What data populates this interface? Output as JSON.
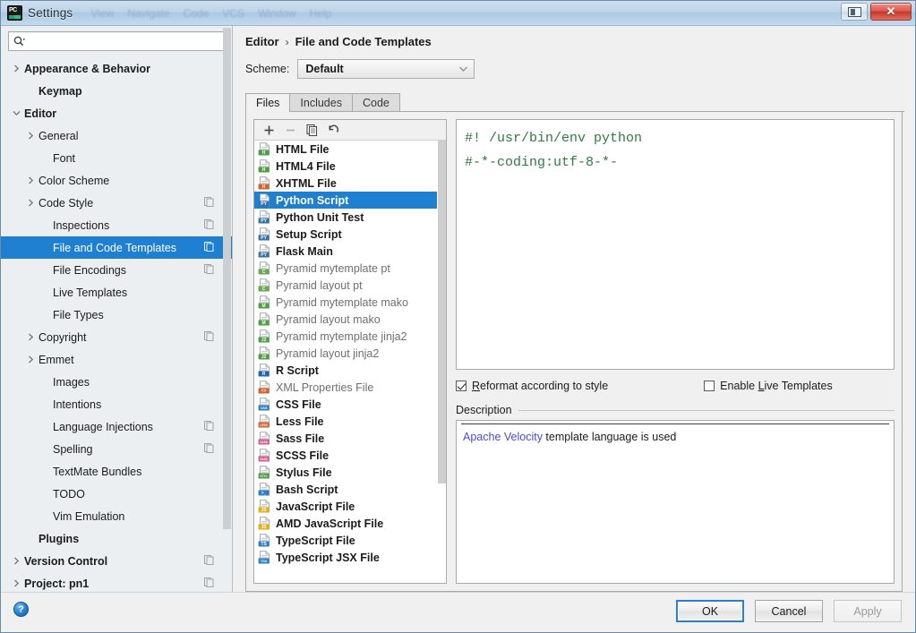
{
  "window": {
    "title": "Settings",
    "app_icon": "pycharm-icon",
    "ghost_menu": [
      "View",
      "Navigate",
      "Code",
      "VCS",
      "Window",
      "Help"
    ],
    "restore_label": "",
    "close_label": "✕"
  },
  "search": {
    "value": "",
    "placeholder": ""
  },
  "sidebar": {
    "items": [
      {
        "label": "Appearance & Behavior",
        "bold": true,
        "indent": 0,
        "twisty": "collapsed",
        "badge": false,
        "selected": false
      },
      {
        "label": "Keymap",
        "bold": true,
        "indent": 1,
        "twisty": "none",
        "badge": false,
        "selected": false
      },
      {
        "label": "Editor",
        "bold": true,
        "indent": 0,
        "twisty": "expanded",
        "badge": false,
        "selected": false
      },
      {
        "label": "General",
        "bold": false,
        "indent": 1,
        "twisty": "collapsed",
        "badge": false,
        "selected": false
      },
      {
        "label": "Font",
        "bold": false,
        "indent": 2,
        "twisty": "none",
        "badge": false,
        "selected": false
      },
      {
        "label": "Color Scheme",
        "bold": false,
        "indent": 1,
        "twisty": "collapsed",
        "badge": false,
        "selected": false
      },
      {
        "label": "Code Style",
        "bold": false,
        "indent": 1,
        "twisty": "collapsed",
        "badge": true,
        "selected": false
      },
      {
        "label": "Inspections",
        "bold": false,
        "indent": 2,
        "twisty": "none",
        "badge": true,
        "selected": false
      },
      {
        "label": "File and Code Templates",
        "bold": false,
        "indent": 2,
        "twisty": "none",
        "badge": true,
        "selected": true
      },
      {
        "label": "File Encodings",
        "bold": false,
        "indent": 2,
        "twisty": "none",
        "badge": true,
        "selected": false
      },
      {
        "label": "Live Templates",
        "bold": false,
        "indent": 2,
        "twisty": "none",
        "badge": false,
        "selected": false
      },
      {
        "label": "File Types",
        "bold": false,
        "indent": 2,
        "twisty": "none",
        "badge": false,
        "selected": false
      },
      {
        "label": "Copyright",
        "bold": false,
        "indent": 1,
        "twisty": "collapsed",
        "badge": true,
        "selected": false
      },
      {
        "label": "Emmet",
        "bold": false,
        "indent": 1,
        "twisty": "collapsed",
        "badge": false,
        "selected": false
      },
      {
        "label": "Images",
        "bold": false,
        "indent": 2,
        "twisty": "none",
        "badge": false,
        "selected": false
      },
      {
        "label": "Intentions",
        "bold": false,
        "indent": 2,
        "twisty": "none",
        "badge": false,
        "selected": false
      },
      {
        "label": "Language Injections",
        "bold": false,
        "indent": 2,
        "twisty": "none",
        "badge": true,
        "selected": false
      },
      {
        "label": "Spelling",
        "bold": false,
        "indent": 2,
        "twisty": "none",
        "badge": true,
        "selected": false
      },
      {
        "label": "TextMate Bundles",
        "bold": false,
        "indent": 2,
        "twisty": "none",
        "badge": false,
        "selected": false
      },
      {
        "label": "TODO",
        "bold": false,
        "indent": 2,
        "twisty": "none",
        "badge": false,
        "selected": false
      },
      {
        "label": "Vim Emulation",
        "bold": false,
        "indent": 2,
        "twisty": "none",
        "badge": false,
        "selected": false
      },
      {
        "label": "Plugins",
        "bold": true,
        "indent": 1,
        "twisty": "none",
        "badge": false,
        "selected": false
      },
      {
        "label": "Version Control",
        "bold": true,
        "indent": 0,
        "twisty": "collapsed",
        "badge": true,
        "selected": false
      },
      {
        "label": "Project: pn1",
        "bold": true,
        "indent": 0,
        "twisty": "collapsed",
        "badge": true,
        "selected": false
      }
    ]
  },
  "main": {
    "breadcrumb": {
      "parent": "Editor",
      "separator": "›",
      "current": "File and Code Templates"
    },
    "scheme": {
      "label": "Scheme:",
      "value": "Default"
    },
    "tabs": [
      {
        "label": "Files",
        "active": true
      },
      {
        "label": "Includes",
        "active": false
      },
      {
        "label": "Code",
        "active": false
      }
    ],
    "list_toolbar": [
      {
        "name": "add-template-button",
        "glyph": "+",
        "disabled": false
      },
      {
        "name": "remove-template-button",
        "glyph": "−",
        "disabled": true
      },
      {
        "name": "copy-template-button",
        "glyph": "copy",
        "disabled": false
      },
      {
        "name": "reset-template-button",
        "glyph": "undo",
        "disabled": false
      }
    ],
    "templates": [
      {
        "label": "HTML File",
        "bold": true,
        "icon": "html-file-icon",
        "badge": "H",
        "badge_color": "#4f9e46",
        "selected": false
      },
      {
        "label": "HTML4 File",
        "bold": true,
        "icon": "html4-file-icon",
        "badge": "H",
        "badge_color": "#4f9e46",
        "selected": false
      },
      {
        "label": "XHTML File",
        "bold": true,
        "icon": "xhtml-file-icon",
        "badge": "H",
        "badge_color": "#d4622b",
        "selected": false
      },
      {
        "label": "Python Script",
        "bold": true,
        "icon": "python-file-icon",
        "badge": "PY",
        "badge_color": "#3572a5",
        "selected": true
      },
      {
        "label": "Python Unit Test",
        "bold": true,
        "icon": "python-file-icon",
        "badge": "PY",
        "badge_color": "#3572a5",
        "selected": false
      },
      {
        "label": "Setup Script",
        "bold": true,
        "icon": "python-file-icon",
        "badge": "PY",
        "badge_color": "#3572a5",
        "selected": false
      },
      {
        "label": "Flask Main",
        "bold": true,
        "icon": "python-file-icon",
        "badge": "PY",
        "badge_color": "#3572a5",
        "selected": false
      },
      {
        "label": "Pyramid mytemplate pt",
        "bold": false,
        "icon": "chameleon-file-icon",
        "badge": "C",
        "badge_color": "#6aa84f",
        "selected": false
      },
      {
        "label": "Pyramid layout pt",
        "bold": false,
        "icon": "chameleon-file-icon",
        "badge": "C",
        "badge_color": "#6aa84f",
        "selected": false
      },
      {
        "label": "Pyramid mytemplate mako",
        "bold": false,
        "icon": "mako-file-icon",
        "badge": "M",
        "badge_color": "#4f9e46",
        "selected": false
      },
      {
        "label": "Pyramid layout mako",
        "bold": false,
        "icon": "mako-file-icon",
        "badge": "M",
        "badge_color": "#4f9e46",
        "selected": false
      },
      {
        "label": "Pyramid mytemplate jinja2",
        "bold": false,
        "icon": "jinja2-file-icon",
        "badge": "J2",
        "badge_color": "#4f9e46",
        "selected": false
      },
      {
        "label": "Pyramid layout jinja2",
        "bold": false,
        "icon": "jinja2-file-icon",
        "badge": "J2",
        "badge_color": "#4f9e46",
        "selected": false
      },
      {
        "label": "R Script",
        "bold": true,
        "icon": "r-script-icon",
        "badge": "R",
        "badge_color": "#2063b8",
        "selected": false
      },
      {
        "label": "XML Properties File",
        "bold": false,
        "icon": "xml-properties-icon",
        "badge": "<>",
        "badge_color": "#d4622b",
        "selected": false
      },
      {
        "label": "CSS File",
        "bold": true,
        "icon": "css-file-icon",
        "badge": "CSS",
        "badge_color": "#2f7ec4",
        "selected": false
      },
      {
        "label": "Less File",
        "bold": true,
        "icon": "less-file-icon",
        "badge": "LESS",
        "badge_color": "#d4622b",
        "selected": false
      },
      {
        "label": "Sass File",
        "bold": true,
        "icon": "sass-file-icon",
        "badge": "SASS",
        "badge_color": "#cf5c8e",
        "selected": false
      },
      {
        "label": "SCSS File",
        "bold": true,
        "icon": "scss-file-icon",
        "badge": "SASS",
        "badge_color": "#cf5c8e",
        "selected": false
      },
      {
        "label": "Stylus File",
        "bold": true,
        "icon": "stylus-file-icon",
        "badge": "STYL",
        "badge_color": "#4f9e46",
        "selected": false
      },
      {
        "label": "Bash Script",
        "bold": true,
        "icon": "bash-script-icon",
        "badge": ">_",
        "badge_color": "#2f7ec4",
        "selected": false
      },
      {
        "label": "JavaScript File",
        "bold": true,
        "icon": "javascript-file-icon",
        "badge": "JS",
        "badge_color": "#e0b014",
        "selected": false
      },
      {
        "label": "AMD JavaScript File",
        "bold": true,
        "icon": "javascript-file-icon",
        "badge": "JS",
        "badge_color": "#e0b014",
        "selected": false
      },
      {
        "label": "TypeScript File",
        "bold": true,
        "icon": "typescript-file-icon",
        "badge": "TS",
        "badge_color": "#2f7ec4",
        "selected": false
      },
      {
        "label": "TypeScript JSX File",
        "bold": true,
        "icon": "typescript-jsx-icon",
        "badge": "TSX",
        "badge_color": "#2f7ec4",
        "selected": false
      }
    ],
    "editor": {
      "lines": [
        "#! /usr/bin/env python",
        "#-*-coding:utf-8-*-"
      ],
      "comment_color": "#2f7a3e"
    },
    "checkboxes": [
      {
        "label": "Reformat according to style",
        "checked": true,
        "mnemonic": "R"
      },
      {
        "label": "Enable Live Templates",
        "checked": false,
        "mnemonic": "L"
      }
    ],
    "description": {
      "title": "Description",
      "link_text": "Apache Velocity",
      "rest_text": " template language is used"
    }
  },
  "footer": {
    "help_glyph": "?",
    "buttons": [
      {
        "label": "OK",
        "state": "focused"
      },
      {
        "label": "Cancel",
        "state": "normal"
      },
      {
        "label": "Apply",
        "state": "disabled"
      }
    ]
  }
}
